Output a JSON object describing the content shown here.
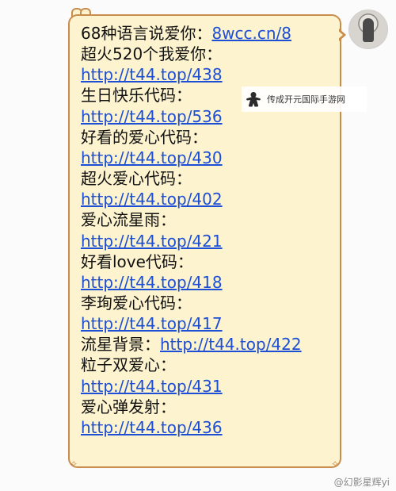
{
  "message": {
    "lines": [
      {
        "text": "68种语言说爱你：",
        "link": "8wcc.cn/8"
      },
      {
        "text": "超火520个我爱你：",
        "link": ""
      },
      {
        "text": "",
        "link": "http://t44.top/438"
      },
      {
        "text": "生日快乐代码：",
        "link": ""
      },
      {
        "text": "",
        "link": "http://t44.top/536"
      },
      {
        "text": "好看的爱心代码：",
        "link": ""
      },
      {
        "text": "",
        "link": "http://t44.top/430"
      },
      {
        "text": "超火爱心代码：",
        "link": ""
      },
      {
        "text": "",
        "link": "http://t44.top/402"
      },
      {
        "text": "爱心流星雨：",
        "link": ""
      },
      {
        "text": "",
        "link": "http://t44.top/421"
      },
      {
        "text": "好看love代码：",
        "link": ""
      },
      {
        "text": "",
        "link": "http://t44.top/418"
      },
      {
        "text": "李珣爱心代码：",
        "link": ""
      },
      {
        "text": "",
        "link": "http://t44.top/417"
      },
      {
        "text": "流星背景：",
        "link": "http://t44.top/422"
      },
      {
        "text": "粒子双爱心：",
        "link": ""
      },
      {
        "text": "",
        "link": "http://t44.top/431"
      },
      {
        "text": "爱心弹发射：",
        "link": ""
      },
      {
        "text": "",
        "link": "http://t44.top/436"
      }
    ]
  },
  "watermark": {
    "text": "传成开元国际手游网",
    "icon": "meeple-icon"
  },
  "footer_watermark": "@幻影星辉yi",
  "avatar": {
    "icon": "avatar-photo"
  },
  "colors": {
    "bubble_bg": "#fdf3cf",
    "bubble_border": "#c88c4d",
    "link": "#1c4fd6",
    "text": "#111111"
  }
}
